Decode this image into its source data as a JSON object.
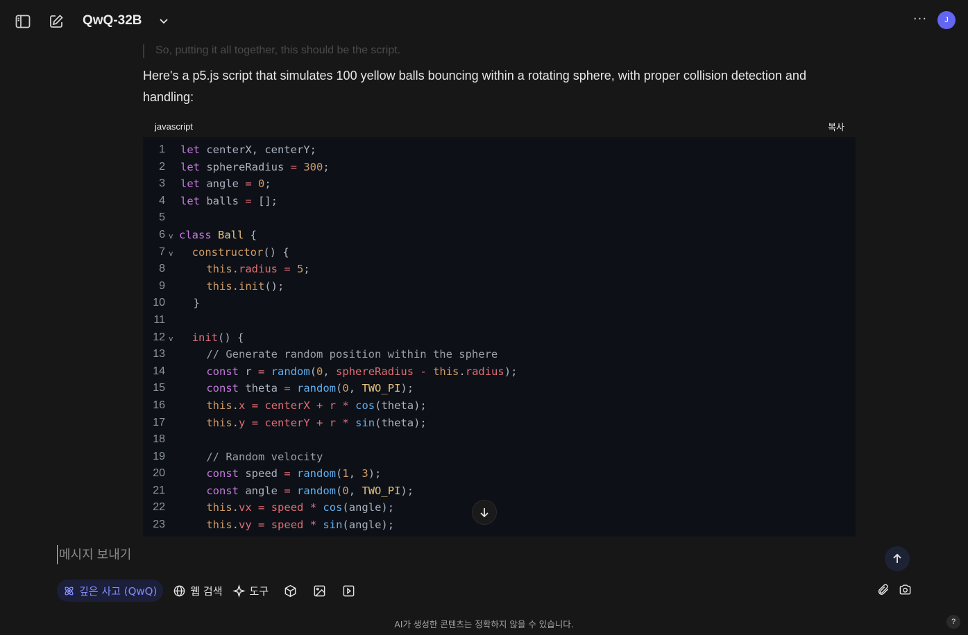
{
  "header": {
    "model_name": "QwQ-32B",
    "avatar_initial": "J",
    "more_label": "···"
  },
  "chat": {
    "faded_line": "So, putting it all together, this should be the script.",
    "intro_text": "Here's a p5.js script that simulates 100 yellow balls bouncing within a rotating sphere, with proper collision detection and handling:",
    "code_block": {
      "language": "javascript",
      "copy_label": "복사"
    }
  },
  "input": {
    "placeholder": "메시지 보내기",
    "deep_think_label": "깊은 사고 (QwQ)",
    "web_search_label": "웹 검색",
    "tools_label": "도구"
  },
  "footer": {
    "disclaimer": "AI가 생성한 콘텐츠는 정확하지 않을 수 있습니다.",
    "help_label": "?"
  }
}
